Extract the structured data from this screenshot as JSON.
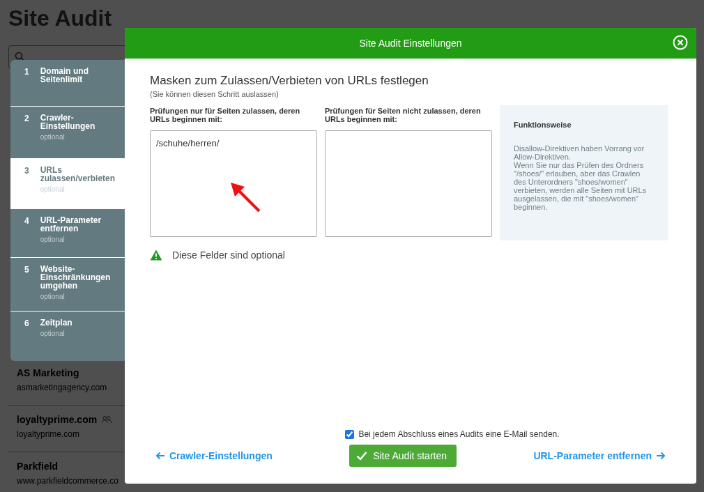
{
  "background_page": {
    "title": "Site Audit",
    "projects": [
      {
        "name": "AS Marketing",
        "domain": "asmarketingagency.com",
        "shared": false
      },
      {
        "name": "loyaltyprime.com",
        "domain": "loyaltyprime.com",
        "shared": true
      },
      {
        "name": "Parkfield",
        "domain": "www.parkfieldcommerce.co",
        "shared": false
      }
    ]
  },
  "steps": [
    {
      "number": "1",
      "title": "Domain und Seitenlimit",
      "selected": false
    },
    {
      "number": "2",
      "title": "Crawler-Einstellungen",
      "note": "optional",
      "selected": false
    },
    {
      "number": "3",
      "title": "URLs zulassen/verbieten",
      "note": "optional",
      "selected": true
    },
    {
      "number": "4",
      "title": "URL-Parameter entfernen",
      "note": "optional",
      "selected": false
    },
    {
      "number": "5",
      "title": "Website-Einschränkungen umgehen",
      "note": "optional",
      "selected": false
    },
    {
      "number": "6",
      "title": "Zeitplan",
      "note": "optional",
      "selected": false
    }
  ],
  "dialog": {
    "title": "Site Audit Einstellungen",
    "heading": "Masken zum Zulassen/Verbieten von URLs festlegen",
    "subheading": "(Sie können diesen Schritt auslassen)",
    "fields": [
      {
        "label": "Prüfungen nur für Seiten zulassen, deren URLs beginnen mit:",
        "value": "/schuhe/herren/"
      },
      {
        "label": "Prüfungen für Seiten nicht zulassen, deren URLs beginnen mit:"
      }
    ],
    "info": {
      "title": "Funktionsweise",
      "text": "Disallow-Direktiven haben Vorrang vor Allow-Direktiven.\nWenn Sie nur das Prüfen des Ordners \"/shoes/\" erlauben, aber das Crawlen des Unterordners \"shoes/women\" verbieten, werden alle Seiten mit URLs ausgelassen, die mit \"shoes/women\" beginnen."
    },
    "warning": "Diese Felder sind optional",
    "email_checkbox": {
      "label": "Bei jedem Abschluss eines Audits eine E-Mail senden.",
      "checked": true
    },
    "back_link": "Crawler-Einstellungen",
    "start_button": "Site Audit starten",
    "next_link": "URL-Parameter entfernen"
  }
}
